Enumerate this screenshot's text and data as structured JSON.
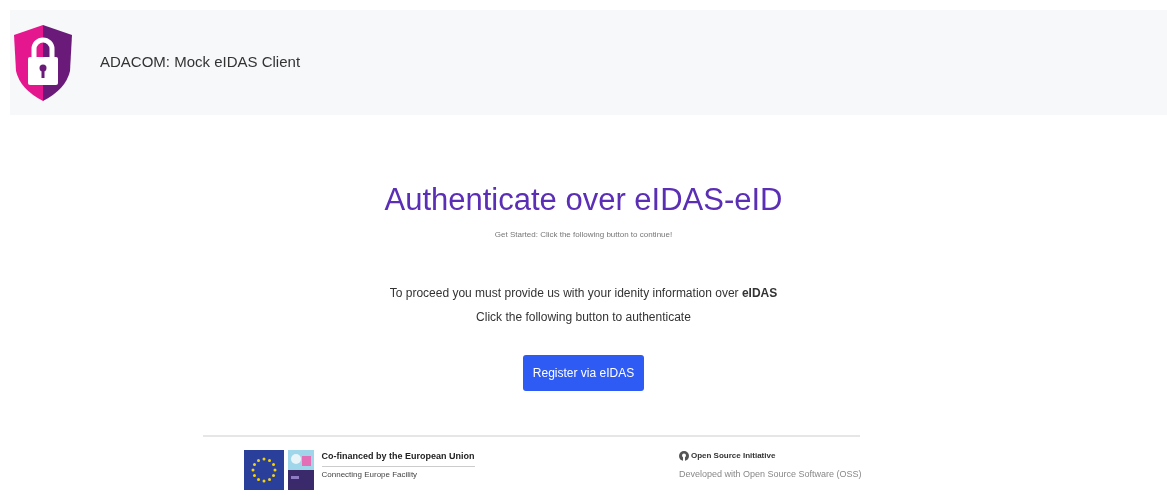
{
  "header": {
    "title": "ADACOM: Mock eIDAS Client"
  },
  "main": {
    "heading": "Authenticate over eIDAS-eID",
    "subheading": "Get Started: Click the following button to continue!",
    "lines": [
      "To proceed you must provide us with your idenity information over **eIDAS**",
      "Click the following button to authenticate"
    ],
    "button": "Register via eIDAS"
  },
  "footer": {
    "eu": {
      "title": "Co-financed by the European Union",
      "subtitle": "Connecting Europe Facility"
    },
    "oss": {
      "title": "Open Source Initiative",
      "subtitle": "Developed with Open Source Software (OSS)"
    }
  }
}
